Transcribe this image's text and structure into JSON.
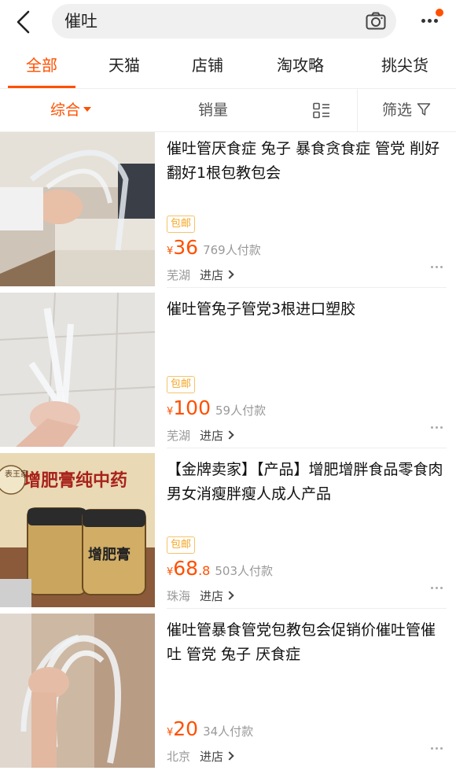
{
  "header": {
    "search_query": "催吐",
    "icons": {
      "back": "chevron-left-icon",
      "camera": "camera-icon",
      "more": "more-dots-icon"
    },
    "accent_color": "#ff5000"
  },
  "tabs": [
    {
      "label": "全部",
      "active": true
    },
    {
      "label": "天猫",
      "active": false
    },
    {
      "label": "店铺",
      "active": false
    },
    {
      "label": "淘攻略",
      "active": false
    },
    {
      "label": "挑尖货",
      "active": false
    }
  ],
  "sortbar": {
    "comprehensive": "综合",
    "sales": "销量",
    "filter": "筛选"
  },
  "products": [
    {
      "title": "催吐管厌食症 兔子 暴食贪食症 管党 削好翻好1根包教包会",
      "tag": "包邮",
      "yen": "¥",
      "price": "36",
      "price_decimal": "",
      "sales": "769人付款",
      "location": "芜湖",
      "shop_link": "进店"
    },
    {
      "title": "催吐管兔子管党3根进口塑胶",
      "tag": "包邮",
      "yen": "¥",
      "price": "100",
      "price_decimal": "",
      "sales": "59人付款",
      "location": "芜湖",
      "shop_link": "进店"
    },
    {
      "title": "【金牌卖家】【产品】增肥增胖食品零食肉男女消瘦胖瘦人成人产品",
      "tag": "包邮",
      "yen": "¥",
      "price": "68",
      "price_decimal": ".8",
      "sales": "503人付款",
      "location": "珠海",
      "shop_link": "进店",
      "image_text": {
        "banner": "增肥膏纯中药",
        "seal": "表王家",
        "jar": "增肥膏"
      }
    },
    {
      "title": "催吐管暴食管党包教包会促销价催吐管催吐 管党 兔子 厌食症",
      "tag": "",
      "yen": "¥",
      "price": "20",
      "price_decimal": "",
      "sales": "34人付款",
      "location": "北京",
      "shop_link": "进店"
    }
  ]
}
